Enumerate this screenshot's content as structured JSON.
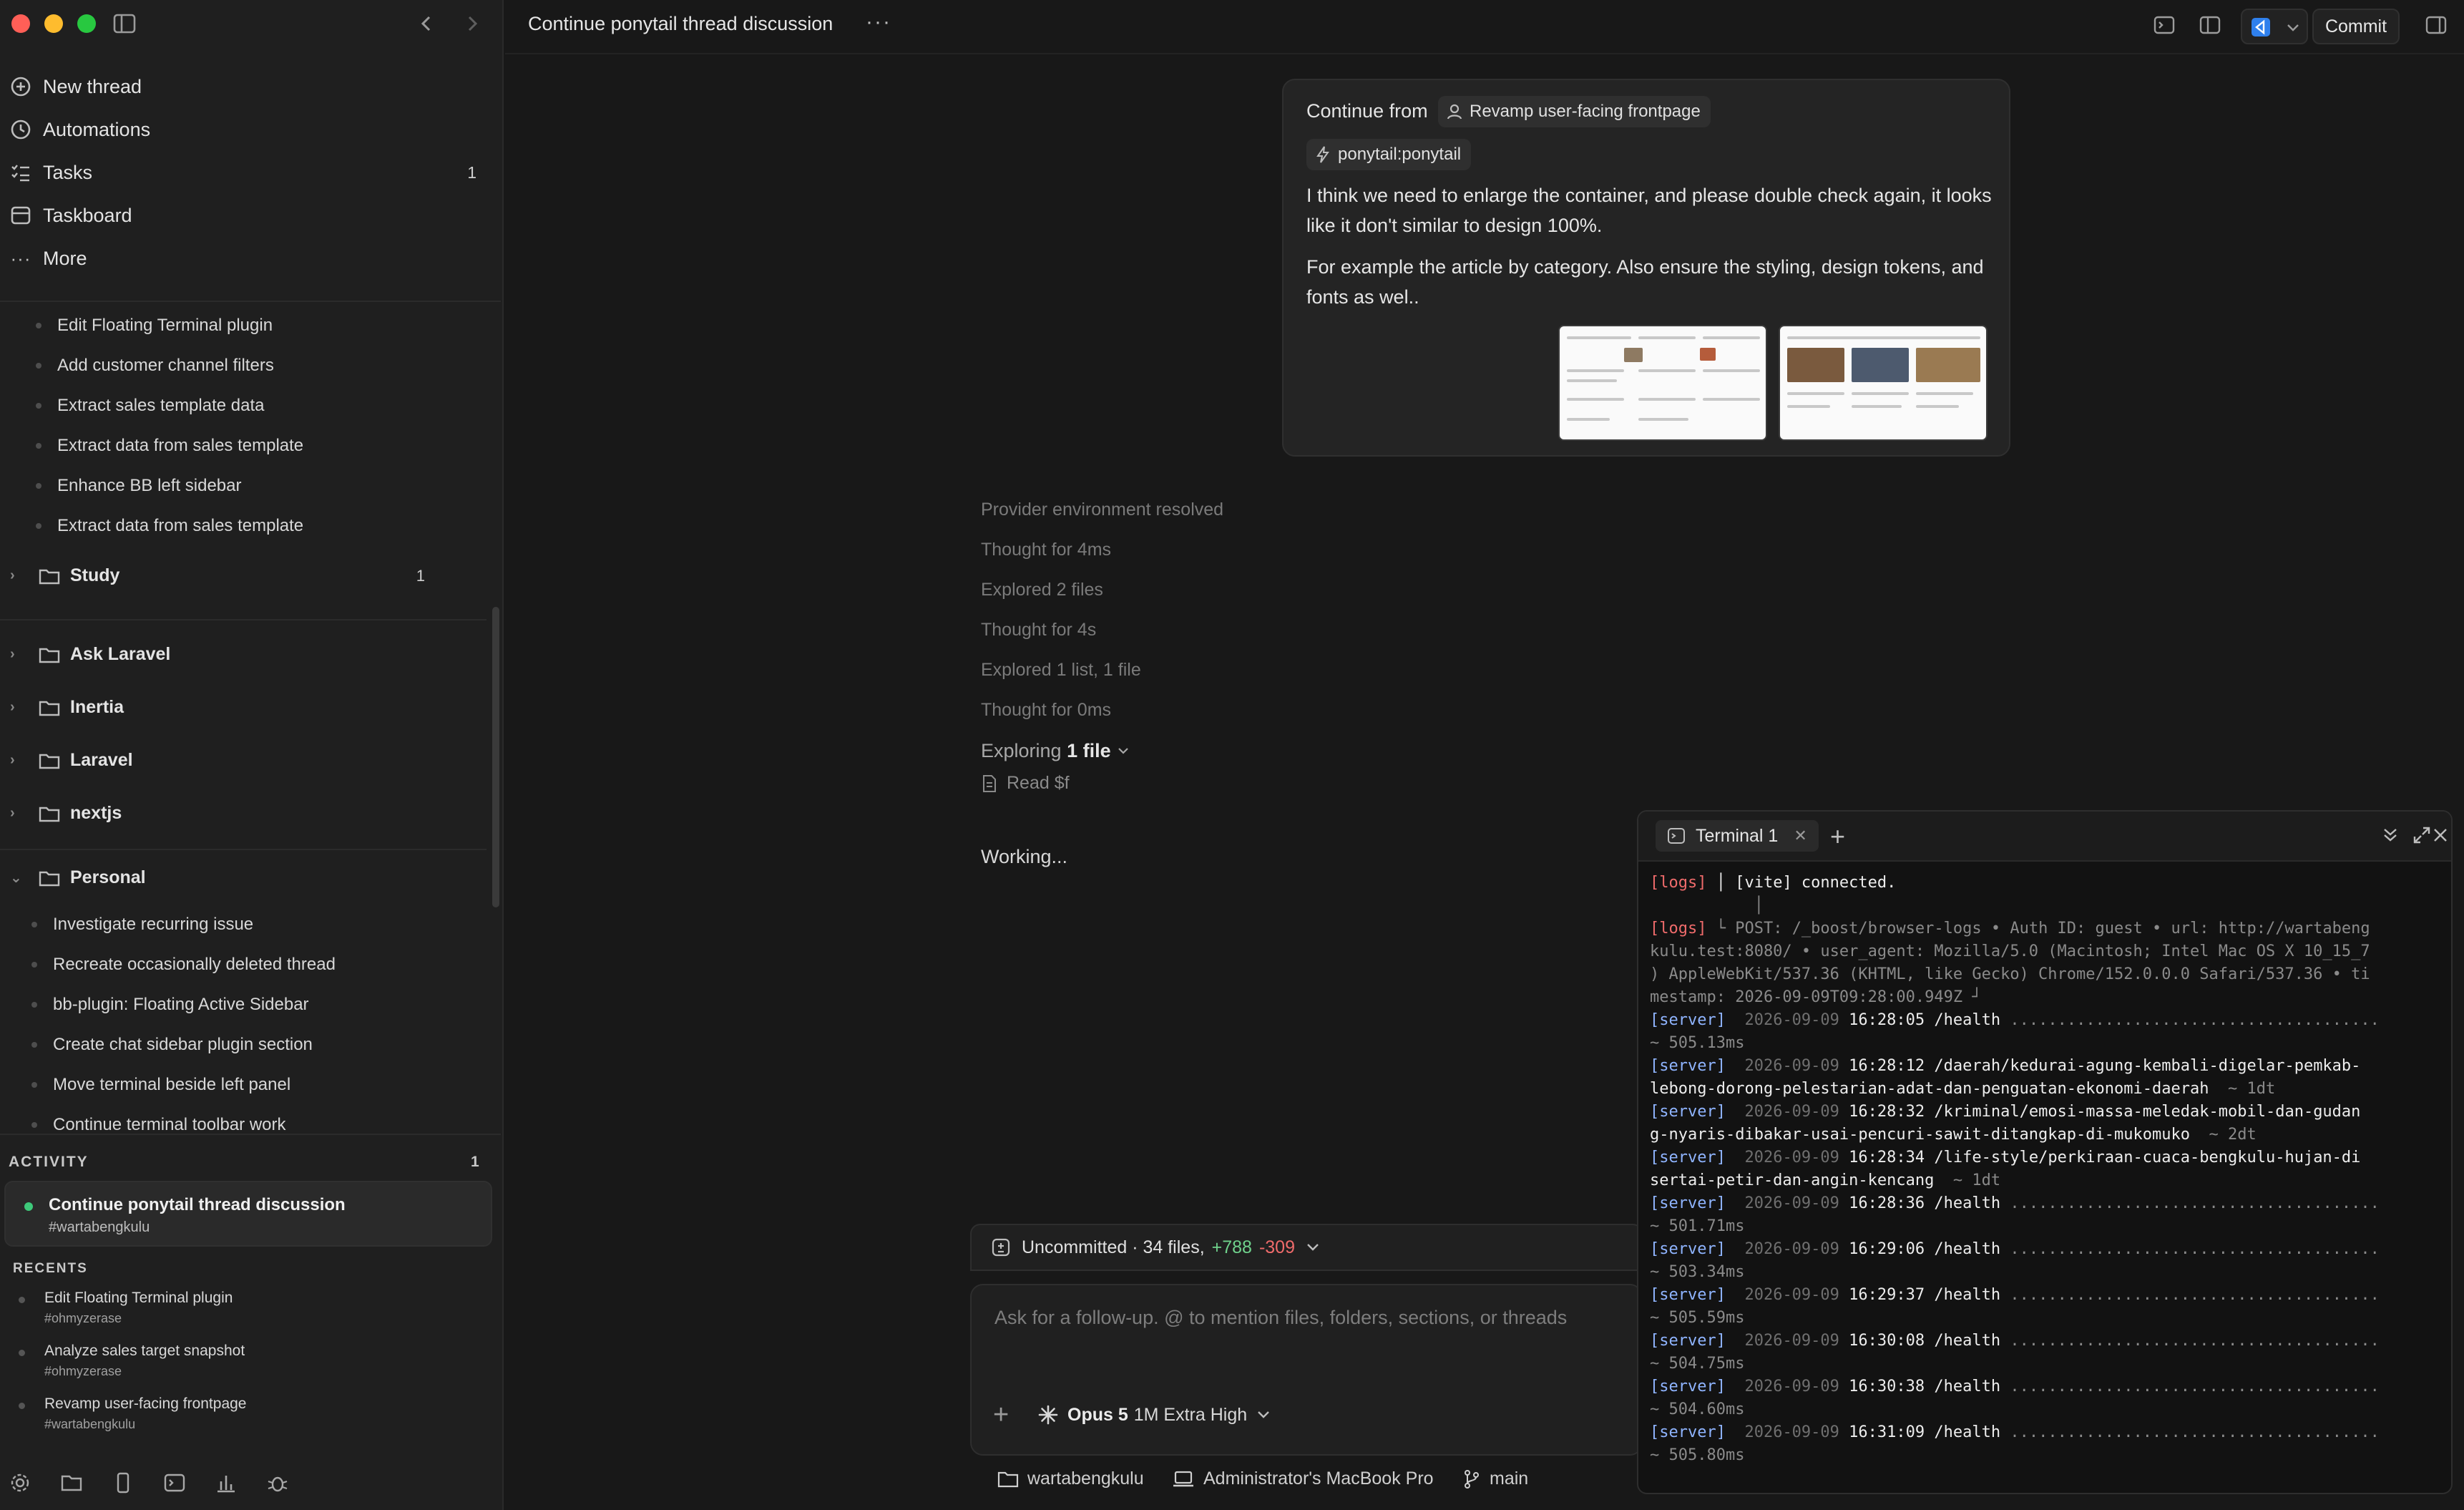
{
  "sidebar": {
    "nav": [
      {
        "label": "New thread",
        "count": ""
      },
      {
        "label": "Automations",
        "count": ""
      },
      {
        "label": "Tasks",
        "count": "1"
      },
      {
        "label": "Taskboard",
        "count": ""
      },
      {
        "label": "More",
        "count": ""
      }
    ],
    "sub_items_top": [
      "Edit Floating Terminal plugin",
      "Add customer channel filters",
      "Extract sales template data",
      "Extract data from sales template",
      "Enhance BB left sidebar",
      "Extract data from sales template"
    ],
    "folders_collapsed": [
      {
        "label": "Study",
        "count": "1"
      },
      {
        "label": "Ask Laravel",
        "count": ""
      },
      {
        "label": "Inertia",
        "count": ""
      },
      {
        "label": "Laravel",
        "count": ""
      },
      {
        "label": "nextjs",
        "count": ""
      }
    ],
    "personal_folder": {
      "label": "Personal",
      "items": [
        "Investigate recurring issue",
        "Recreate occasionally deleted thread",
        "bb-plugin: Floating Active Sidebar",
        "Create chat sidebar plugin section",
        "Move terminal beside left panel",
        "Continue terminal toolbar work"
      ]
    },
    "activity": {
      "label": "ACTIVITY",
      "count": "1",
      "item": {
        "title": "Continue ponytail thread discussion",
        "project": "#wartabengkulu"
      }
    },
    "recents": {
      "label": "RECENTS",
      "items": [
        {
          "title": "Edit Floating Terminal plugin",
          "project": "#ohmyzerase"
        },
        {
          "title": "Analyze sales target snapshot",
          "project": "#ohmyzerase"
        },
        {
          "title": "Revamp user-facing frontpage",
          "project": "#wartabengkulu"
        }
      ]
    }
  },
  "header": {
    "title": "Continue ponytail thread discussion",
    "more": "···",
    "commit_label": "Commit"
  },
  "message": {
    "continue_from_label": "Continue from",
    "continue_from_chip": "Revamp user-facing frontpage",
    "branch_chip": "ponytail:ponytail",
    "paragraph1": "I think we need to enlarge the container, and please double check again, it looks like it don't similar to design 100%.",
    "paragraph2": "For example the article by category. Also ensure the styling, design tokens, and fonts as wel.."
  },
  "log": {
    "lines": [
      "Provider environment resolved",
      "Thought for 4ms",
      "Explored 2 files",
      "Thought for 4s",
      "Explored 1 list, 1 file",
      "Thought for 0ms"
    ],
    "exploring_prefix": "Exploring",
    "exploring_bold": "1 file",
    "read_line": "Read $f",
    "working": "Working..."
  },
  "composer": {
    "uncommitted_label": "Uncommitted · 34 files,",
    "additions": "+788",
    "deletions": "-309",
    "placeholder": "Ask for a follow-up. @ to mention files, folders, sections, or threads",
    "model_name": "Opus 5",
    "model_variant": "1M Extra High"
  },
  "status_bar": {
    "project": "wartabengkulu",
    "machine": "Administrator's MacBook Pro",
    "branch": "main"
  },
  "terminal": {
    "tab_label": "Terminal 1",
    "lines": [
      {
        "tag": "[logs]",
        "tag_class": "logs",
        "date": "",
        "time": "",
        "path": " │ [vite] connected.",
        "tail": ""
      },
      {
        "tag": "",
        "tag_class": "",
        "date": "",
        "time": "",
        "path": "",
        "tail": "           │"
      },
      {
        "tag": "[logs]",
        "tag_class": "logs",
        "date": "",
        "time": "",
        "path": "",
        "tail": " └ POST: /_boost/browser-logs • Auth ID: guest • url: http://wartabeng"
      },
      {
        "tag": "",
        "tag_class": "",
        "date": "",
        "time": "",
        "path": "",
        "tail": "kulu.test:8080/ • user_agent: Mozilla/5.0 (Macintosh; Intel Mac OS X 10_15_7"
      },
      {
        "tag": "",
        "tag_class": "",
        "date": "",
        "time": "",
        "path": "",
        "tail": ") AppleWebKit/537.36 (KHTML, like Gecko) Chrome/152.0.0.0 Safari/537.36 • ti"
      },
      {
        "tag": "",
        "tag_class": "",
        "date": "",
        "time": "",
        "path": "",
        "tail": "mestamp: 2026-09-09T09:28:00.949Z ┘"
      },
      {
        "tag": "[server]",
        "tag_class": "server",
        "date": "  2026-09-09",
        "time": " 16:28:05",
        "path": " /health",
        "tail": " ......................................."
      },
      {
        "tag": "",
        "tag_class": "",
        "date": "",
        "time": "",
        "path": "",
        "tail": "~ 505.13ms"
      },
      {
        "tag": "[server]",
        "tag_class": "server",
        "date": "  2026-09-09",
        "time": " 16:28:12",
        "path": " /daerah/kedurai-agung-kembali-digelar-pemkab-",
        "tail": ""
      },
      {
        "tag": "",
        "tag_class": "",
        "date": "",
        "time": "",
        "path": "lebong-dorong-pelestarian-adat-dan-penguatan-ekonomi-daerah",
        "tail": "  ~ 1dt"
      },
      {
        "tag": "[server]",
        "tag_class": "server",
        "date": "  2026-09-09",
        "time": " 16:28:32",
        "path": " /kriminal/emosi-massa-meledak-mobil-dan-gudan",
        "tail": ""
      },
      {
        "tag": "",
        "tag_class": "",
        "date": "",
        "time": "",
        "path": "g-nyaris-dibakar-usai-pencuri-sawit-ditangkap-di-mukomuko",
        "tail": "  ~ 2dt"
      },
      {
        "tag": "[server]",
        "tag_class": "server",
        "date": "  2026-09-09",
        "time": " 16:28:34",
        "path": " /life-style/perkiraan-cuaca-bengkulu-hujan-di",
        "tail": ""
      },
      {
        "tag": "",
        "tag_class": "",
        "date": "",
        "time": "",
        "path": "sertai-petir-dan-angin-kencang",
        "tail": "  ~ 1dt"
      },
      {
        "tag": "[server]",
        "tag_class": "server",
        "date": "  2026-09-09",
        "time": " 16:28:36",
        "path": " /health",
        "tail": " ......................................."
      },
      {
        "tag": "",
        "tag_class": "",
        "date": "",
        "time": "",
        "path": "",
        "tail": "~ 501.71ms"
      },
      {
        "tag": "[server]",
        "tag_class": "server",
        "date": "  2026-09-09",
        "time": " 16:29:06",
        "path": " /health",
        "tail": " ......................................."
      },
      {
        "tag": "",
        "tag_class": "",
        "date": "",
        "time": "",
        "path": "",
        "tail": "~ 503.34ms"
      },
      {
        "tag": "[server]",
        "tag_class": "server",
        "date": "  2026-09-09",
        "time": " 16:29:37",
        "path": " /health",
        "tail": " ......................................."
      },
      {
        "tag": "",
        "tag_class": "",
        "date": "",
        "time": "",
        "path": "",
        "tail": "~ 505.59ms"
      },
      {
        "tag": "[server]",
        "tag_class": "server",
        "date": "  2026-09-09",
        "time": " 16:30:08",
        "path": " /health",
        "tail": " ......................................."
      },
      {
        "tag": "",
        "tag_class": "",
        "date": "",
        "time": "",
        "path": "",
        "tail": "~ 504.75ms"
      },
      {
        "tag": "[server]",
        "tag_class": "server",
        "date": "  2026-09-09",
        "time": " 16:30:38",
        "path": " /health",
        "tail": " ......................................."
      },
      {
        "tag": "",
        "tag_class": "",
        "date": "",
        "time": "",
        "path": "",
        "tail": "~ 504.60ms"
      },
      {
        "tag": "[server]",
        "tag_class": "server",
        "date": "  2026-09-09",
        "time": " 16:31:09",
        "path": " /health",
        "tail": " ......................................."
      },
      {
        "tag": "",
        "tag_class": "",
        "date": "",
        "time": "",
        "path": "",
        "tail": "~ 505.80ms"
      }
    ]
  },
  "colors": {
    "accent_green": "#3ec97a",
    "diff_add": "#6fd28c",
    "diff_del": "#ef6b6b",
    "vscode_blue": "#2f80ed",
    "log_tag": "#ef6b6b",
    "server_tag": "#8fb4ff"
  }
}
